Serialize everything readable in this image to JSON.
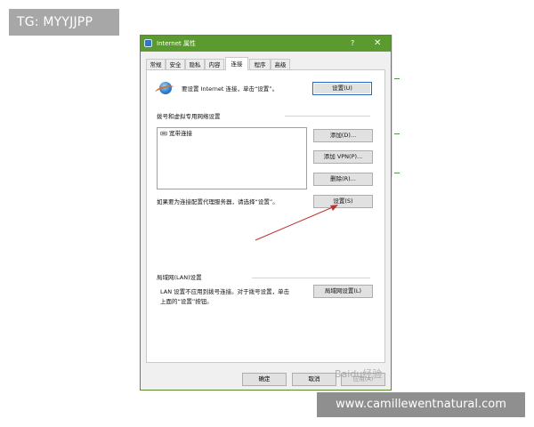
{
  "banners": {
    "tg": "TG: MYYJJPP",
    "website": "www.camillewentnatural.com"
  },
  "window": {
    "title": "Internet 属性",
    "help": "?",
    "close": "✕",
    "accent": "#5a9a2f"
  },
  "tabs": [
    {
      "label": "常规"
    },
    {
      "label": "安全"
    },
    {
      "label": "隐私"
    },
    {
      "label": "内容"
    },
    {
      "label": "连接",
      "active": true
    },
    {
      "label": "程序"
    },
    {
      "label": "高级"
    }
  ],
  "setup": {
    "text": "要设置 Internet 连接，单击“设置”。",
    "button": "设置(U)"
  },
  "dialup": {
    "heading": "拨号和虚拟专用网络设置",
    "list_items": [
      "宽带连接"
    ],
    "add_button": "添加(D)...",
    "add_vpn_button": "添加 VPN(P)...",
    "delete_button": "删除(R)...",
    "proxy_text": "如果要为连接配置代理服务器，请选择“设置”。",
    "settings_button": "设置(S)"
  },
  "lan": {
    "heading": "局域网(LAN)设置",
    "text_line1": "LAN 设置不应用到拨号连接。对于拨号设置，单击",
    "text_line2": "上面的“设置”按钮。",
    "button": "局域网设置(L)"
  },
  "footer": {
    "ok": "确定",
    "cancel": "取消",
    "apply": "应用(A)"
  },
  "watermark": "Baidu经验",
  "icons": {
    "globe": "globe-icon",
    "connection": "network-connection-icon"
  },
  "annotation": {
    "arrow_color": "#c03030"
  }
}
